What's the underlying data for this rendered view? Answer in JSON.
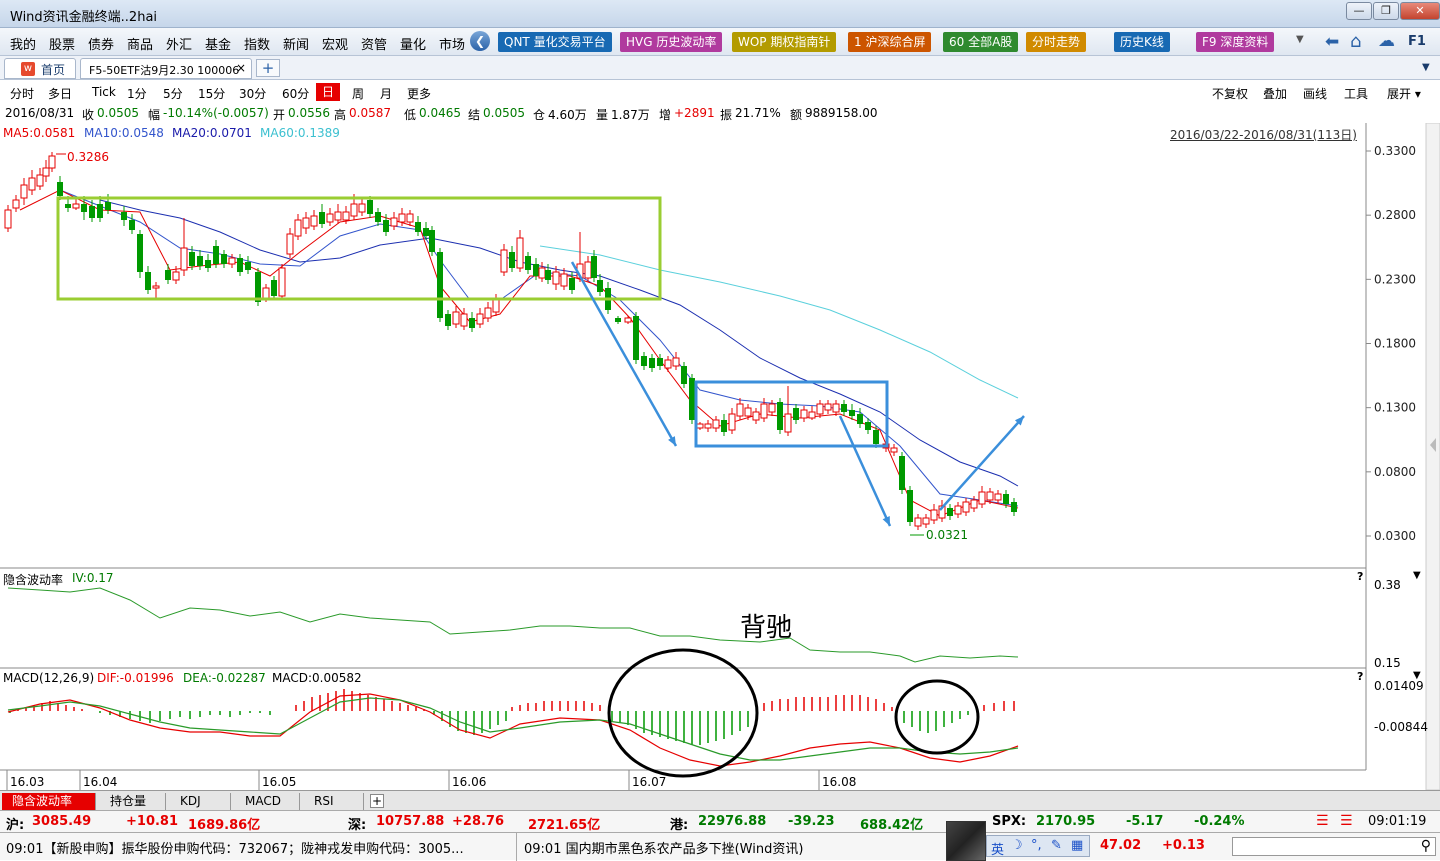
{
  "window": {
    "title": "Wind资讯金融终端..2hai"
  },
  "menu": [
    "我的",
    "股票",
    "债券",
    "商品",
    "外汇",
    "基金",
    "指数",
    "新闻",
    "宏观",
    "资管",
    "量化",
    "市场"
  ],
  "toolbar_pills": [
    {
      "label": "QNT 量化交易平台",
      "color": "#1769b3"
    },
    {
      "label": "HVG 历史波动率",
      "color": "#b03a9e"
    },
    {
      "label": "WOP 期权指南针",
      "color": "#b39b00"
    },
    {
      "label": "1 沪深综合屏",
      "color": "#cc5500"
    },
    {
      "label": "60 全部A股",
      "color": "#2f8a2f"
    },
    {
      "label": "分时走势",
      "color": "#d08a00"
    },
    {
      "label": "历史K线",
      "color": "#1769b3"
    },
    {
      "label": "F9 深度资料",
      "color": "#b03a9e"
    }
  ],
  "right_icons": [
    "back-arrow-icon",
    "home-icon",
    "chat-icon"
  ],
  "f1_label": "F1",
  "tabs": {
    "home": "首页",
    "active": "F5-50ETF沽9月2.30 100006",
    "close": "×",
    "add": "+"
  },
  "periods": [
    "分时",
    "多日",
    "Tick",
    "1分",
    "5分",
    "15分",
    "30分",
    "60分",
    "日",
    "周",
    "月",
    "更多"
  ],
  "active_period": "日",
  "right_tools": [
    "不复权",
    "叠加",
    "画线",
    "工具",
    "展开"
  ],
  "info": {
    "date": "2016/08/31",
    "close_label": "收",
    "close": "0.0505",
    "chg_label": "幅",
    "chg": "-10.14%(-0.0057)",
    "open_label": "开",
    "open": "0.0556",
    "high_label": "高",
    "high": "0.0587",
    "low_label": "低",
    "low": "0.0465",
    "settle_label": "结",
    "settle": "0.0505",
    "oi_label": "仓",
    "oi": "4.60万",
    "vol_label": "量",
    "vol": "1.87万",
    "inc_label": "增",
    "inc": "+2891",
    "amp_label": "振",
    "amp": "21.71%",
    "amt_label": "额",
    "amt": "9889158.00"
  },
  "ma": {
    "ma5": "MA5:0.0581",
    "ma10": "MA10:0.0548",
    "ma20": "MA20:0.0701",
    "ma60": "MA60:0.1389"
  },
  "range_label": "2016/03/22-2016/08/31(113日)",
  "y_ticks": [
    "0.3300",
    "0.2800",
    "0.2300",
    "0.1800",
    "0.1300",
    "0.0800",
    "0.0300"
  ],
  "max_label": "0.3286",
  "min_label": "0.0321",
  "iv": {
    "label": "隐含波动率",
    "value": "IV:0.17",
    "top": "0.38",
    "bottom": "0.15"
  },
  "annotation": "背驰",
  "macd": {
    "label": "MACD(12,26,9)",
    "dif": "DIF:-0.01996",
    "dea": "DEA:-0.02287",
    "macd": "MACD:0.00582",
    "top": "0.01409",
    "bottom": "-0.00844"
  },
  "x_ticks": [
    "16.03",
    "16.04",
    "16.05",
    "16.06",
    "16.07",
    "16.08"
  ],
  "bottom_tabs": [
    "隐含波动率",
    "持仓量",
    "KDJ",
    "MACD",
    "RSI"
  ],
  "status": {
    "sh_label": "沪:",
    "sh": "3085.49",
    "sh_chg": "+10.81",
    "sh_amt": "1689.86亿",
    "sz_label": "深:",
    "sz": "10757.88",
    "sz_chg": "+28.76",
    "sz_amt": "2721.65亿",
    "hk_label": "港:",
    "hk": "22976.88",
    "hk_chg": "-39.23",
    "hk_amt": "688.42亿",
    "spx_label": "SPX:",
    "spx": "2170.95",
    "spx_chg": "-5.17",
    "spx_pct": "-0.24%",
    "time": "09:01:19"
  },
  "news": {
    "left": "09:01【新股申购】振华股份申购代码：732067；陇神戎发申购代码：3005...",
    "right": "09:01 国内期市黑色系农产品多下挫(Wind资讯)",
    "ime": "英",
    "val1": "47.02",
    "val2": "+0.13"
  },
  "chart_data": {
    "type": "candlestick",
    "title": "F5-50ETF沽9月2.30 100006",
    "y_range": [
      0.01,
      0.34
    ],
    "max": 0.3286,
    "min": 0.0321
  }
}
